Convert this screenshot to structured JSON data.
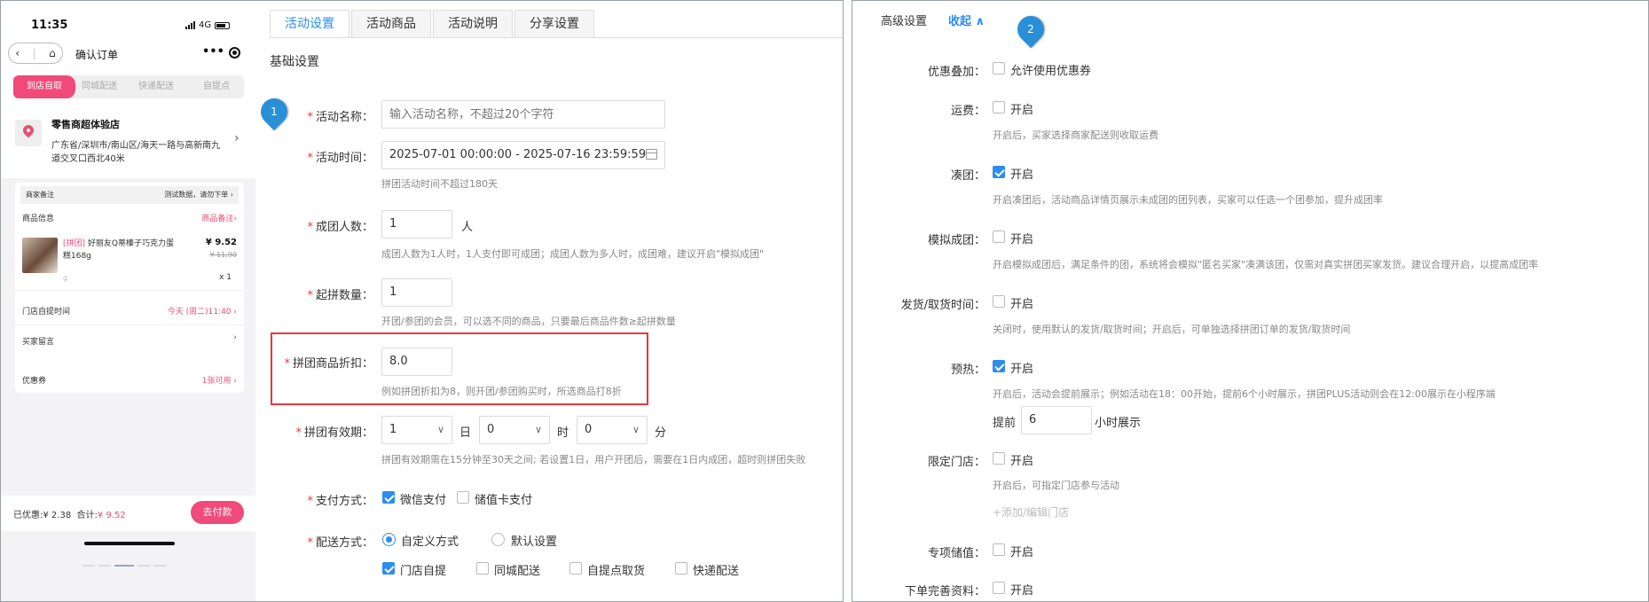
{
  "phone": {
    "status": {
      "time": "11:35",
      "network": "4G"
    },
    "nav": {
      "back_icon": "chevron-left-icon",
      "home_icon": "home-icon",
      "title": "确认订单",
      "more": "•••"
    },
    "delivery_tabs": [
      "到店自取",
      "同城配送",
      "快递配送",
      "自提点"
    ],
    "store": {
      "name": "零售商超体验店",
      "address": "广东省/深圳市/南山区/海天一路与高新南九道交叉口西北40米"
    },
    "merchant_note": {
      "label": "商家备注",
      "value": "测试数据，请勿下单"
    },
    "goods": {
      "header": "商品信息",
      "note_link": "商品备注",
      "tag": "[拼团]",
      "name": "好丽友Q蒂榛子巧克力蛋糕168g",
      "price": "¥ 9.52",
      "original_price": "¥ 11.90",
      "spec": "g",
      "qty": "x 1"
    },
    "pickup_time": {
      "label": "门店自提时间",
      "value": "今天 (周二)11:40"
    },
    "buyer_msg": {
      "label": "买家留言"
    },
    "coupon": {
      "label": "优惠券",
      "value": "1张可用"
    },
    "footer": {
      "discount_label": "已优惠:",
      "discount": "¥ 2.38",
      "total_label": "合计:",
      "total": "¥ 9.52",
      "pay_button": "去付款"
    }
  },
  "tabs": [
    "活动设置",
    "活动商品",
    "活动说明",
    "分享设置"
  ],
  "active_tab": 0,
  "basic": {
    "title": "基础设置",
    "name": {
      "label": "活动名称：",
      "placeholder": "输入活动名称，不超过20个字符"
    },
    "time": {
      "label": "活动时间：",
      "value": "2025-07-01 00:00:00 - 2025-07-16 23:59:59",
      "hint": "拼团活动时间不超过180天"
    },
    "group_size": {
      "label": "成团人数：",
      "value": "1",
      "unit": "人",
      "hint": "成团人数为1人时，1人支付即可成团；成团人数为多人时，成团难，建议开启\"模拟成团\""
    },
    "min_qty": {
      "label": "起拼数量：",
      "value": "1",
      "hint": "开团/参团的会员，可以选不同的商品，只要最后商品件数≥起拼数量"
    },
    "discount": {
      "label": "拼团商品折扣：",
      "value": "8.0",
      "hint": "例如拼团折扣为8，则开团/参团购买时，所选商品打8折"
    },
    "validity": {
      "label": "拼团有效期：",
      "day": "1",
      "day_unit": "日",
      "hour": "0",
      "hour_unit": "时",
      "minute": "0",
      "minute_unit": "分",
      "hint": "拼团有效期需在15分钟至30天之间; 若设置1日，用户开团后，需要在1日内成团，超时则拼团失败"
    },
    "payment": {
      "label": "支付方式：",
      "options": [
        "微信支付",
        "储值卡支付"
      ],
      "checked": [
        true,
        false
      ]
    },
    "delivery": {
      "label": "配送方式：",
      "mode_options": [
        "自定义方式",
        "默认设置"
      ],
      "mode_selected": 0,
      "options": [
        "门店自提",
        "同城配送",
        "自提点取货",
        "快递配送"
      ],
      "checked": [
        true,
        false,
        false,
        false
      ]
    }
  },
  "markers": [
    "1",
    "2"
  ],
  "advanced": {
    "title": "高级设置",
    "toggle": "收起",
    "stacking": {
      "label": "优惠叠加：",
      "option": "允许使用优惠券",
      "checked": false
    },
    "shipping": {
      "label": "运费：",
      "option": "开启",
      "checked": false,
      "hint": "开启后，买家选择商家配送则收取运费"
    },
    "gather": {
      "label": "凑团：",
      "option": "开启",
      "checked": true,
      "hint": "开启凑团后，活动商品详情页展示未成团的团列表，买家可以任选一个团参加，提升成团率"
    },
    "simulate": {
      "label": "模拟成团：",
      "option": "开启",
      "checked": false,
      "hint": "开启模拟成团后，满足条件的团，系统将会模拟\"匿名买家\"凑满该团，仅需对真实拼团买家发货。建议合理开启，以提高成团率"
    },
    "ship_time": {
      "label": "发货/取货时间：",
      "option": "开启",
      "checked": false,
      "hint": "关闭时，使用默认的发货/取货时间；开启后，可单独选择拼团订单的发货/取货时间"
    },
    "preheat": {
      "label": "预热：",
      "option": "开启",
      "checked": true,
      "hint": "开启后，活动会提前展示；例如活动在18：00开始，提前6个小时展示，拼团PLUS活动则会在12:00展示在小程序端",
      "prefix": "提前",
      "value": "6",
      "suffix": "小时展示"
    },
    "store_limit": {
      "label": "限定门店：",
      "option": "开启",
      "checked": false,
      "hint": "开启后，可指定门店参与活动",
      "link": "+添加/编辑门店"
    },
    "stored_value": {
      "label": "专项储值：",
      "option": "开启",
      "checked": false
    },
    "order_info": {
      "label": "下单完善资料：",
      "option": "开启",
      "checked": false
    }
  }
}
